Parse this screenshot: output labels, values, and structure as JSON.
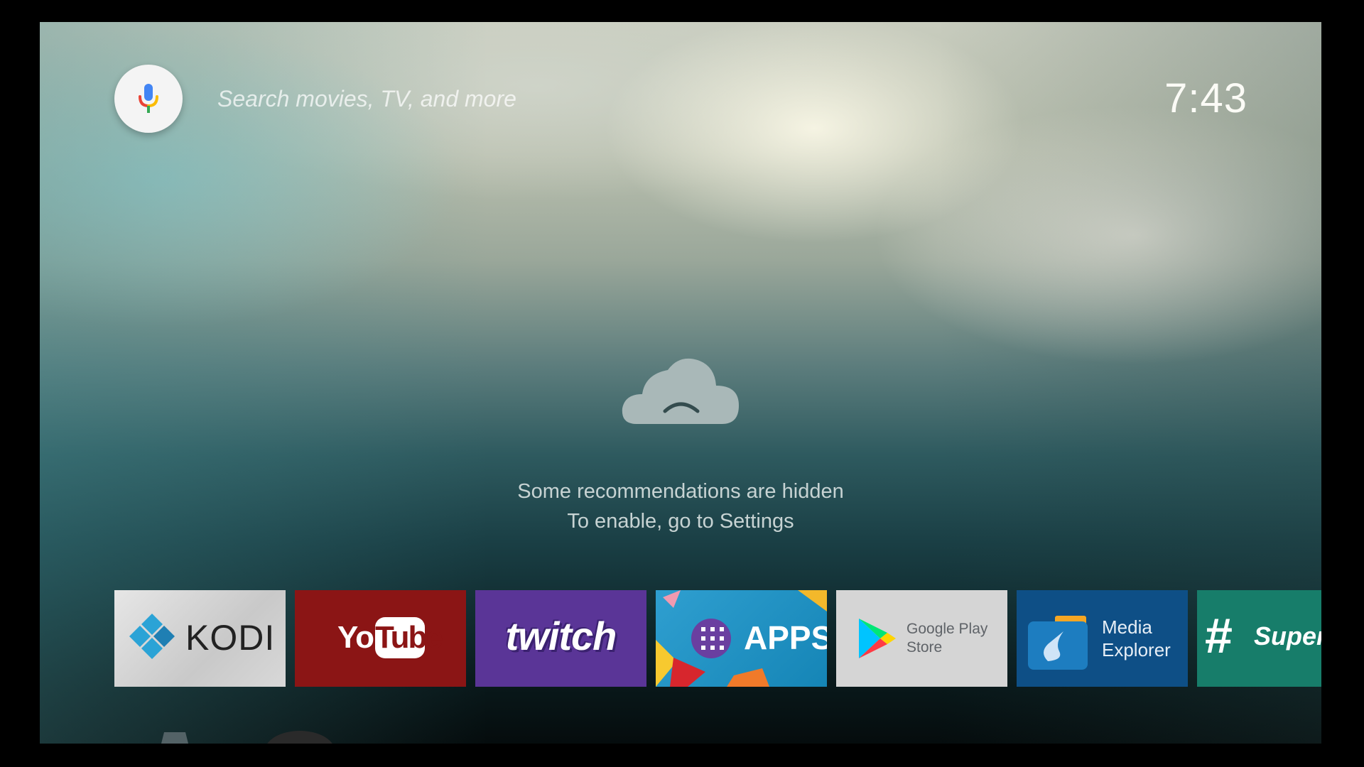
{
  "search": {
    "placeholder": "Search movies, TV, and more",
    "mic_icon": "mic-icon"
  },
  "clock": {
    "time": "7:43"
  },
  "notice": {
    "icon": "cloud-sad-icon",
    "line1": "Some recommendations are hidden",
    "line2": "To enable, go to Settings"
  },
  "apps": [
    {
      "name": "KODI",
      "color": "#cfcfcf"
    },
    {
      "name": "YouTube",
      "you": "You",
      "tube": "Tube",
      "color": "#8b1515"
    },
    {
      "name": "twitch",
      "color": "#5a3597"
    },
    {
      "name": "APPS",
      "color": "#1e90c5"
    },
    {
      "name": "Google Play Store",
      "line1": "Google Play",
      "line2": "Store",
      "color": "#d5d5d5"
    },
    {
      "name": "Media Explorer",
      "line1": "Media",
      "line2": "Explorer",
      "color": "#0e4f86"
    },
    {
      "name": "Super",
      "hash": "#",
      "color": "#177d6a"
    }
  ],
  "bottom_row": {
    "icons": [
      "settings-gear-icon",
      "partial-app-icon"
    ]
  }
}
